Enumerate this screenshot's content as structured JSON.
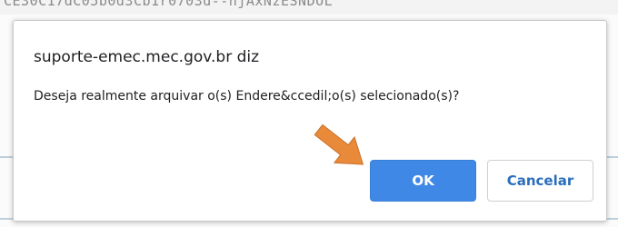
{
  "background": {
    "url_fragment": "CE30C17dC05b0d3Cb1r0703d--njAxNzESNDOL"
  },
  "dialog": {
    "title": "suporte-emec.mec.gov.br diz",
    "message": "Deseja realmente arquivar o(s) Endere&ccedil;o(s) selecionado(s)?",
    "ok_label": "OK",
    "cancel_label": "Cancelar"
  },
  "colors": {
    "ok_button": "#3f88e6",
    "cancel_text": "#2a6ebb",
    "arrow": "#e98a3a"
  },
  "icons": {
    "pointer": "arrow-icon"
  }
}
